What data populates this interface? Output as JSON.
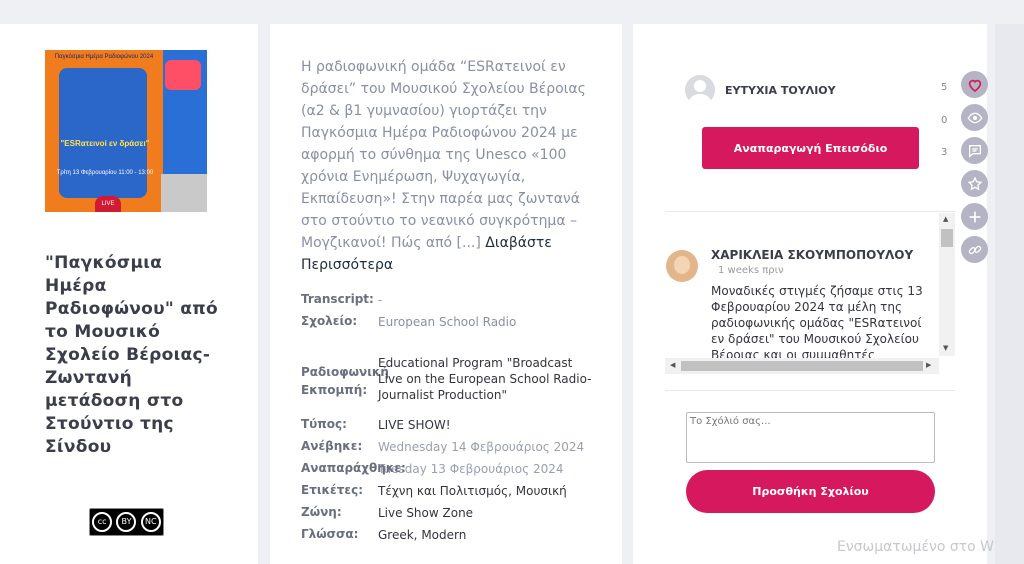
{
  "episode": {
    "poster": {
      "top_text": "Παγκόσμια Ημέρα Ραδιοφώνου 2024",
      "middle_text": "\"ESRατεινοί εν δράσει\"",
      "bottom_text": "Τρίτη 13 Φεβρουαρίου 11:00 - 13:00",
      "live_badge": "LIVE"
    },
    "title": "\"Παγκόσμια Ημέρα Ραδιοφώνου\" από το Μουσικό Σχολείο Βέροιας- Ζωντανή μετάδοση στο Στούντιο της Σίνδου",
    "license": {
      "by": "BY",
      "nc": "NC"
    }
  },
  "description": {
    "text": "Η ραδιοφωνική ομάδα “ESRατεινοί εν δράσει” του Μουσικού Σχολείου Βέροιας (α2 & β1 γυμνασίου) γιορτάζει την Παγκόσμια Ημέρα Ραδιοφώνου 2024 με αφορμή το σύνθημα της Unesco «100 χρόνια Ενημέρωση, Ψυχαγωγία, Εκπαίδευση»! Στην παρέα μας ζωντανά στο στούντιο το νεανικό συγκρότημα – Μογζικανοί! Πώς από",
    "ellipsis": "[...]",
    "read_more": "Διαβάστε Περισσότερα"
  },
  "meta": {
    "transcript_label": "Transcript:",
    "transcript_value": "-",
    "school_label": "Σχολείο:",
    "school_value": "European School Radio",
    "program_label": "Ραδιοφωνική Εκπομπή:",
    "program_value": "Educational Program \"Broadcast Live on the European School Radio- Journalist Production\"",
    "type_label": "Τύπος:",
    "type_value": "LIVE SHOW!",
    "uploaded_label": "Ανέβηκε:",
    "uploaded_value": "Wednesday 14 Φεβρουάριος 2024",
    "played_label": "Αναπαράχθηκε:",
    "played_value": "Tuesday 13 Φεβρουάριος 2024",
    "tags_label": "Ετικέτες:",
    "tags_value": "Τέχνη και Πολιτισμός, Μουσική",
    "zone_label": "Ζώνη:",
    "zone_value": "Live Show Zone",
    "language_label": "Γλώσσα:",
    "language_value": "Greek, Modern"
  },
  "player": {
    "author": "ΕΥΤΥΧΙΑ ΤΟΥΛΙΟΥ",
    "play_label": "Αναπαραγωγή Επεισόδιο"
  },
  "counts": {
    "likes": "5",
    "views": "0",
    "comments": "3"
  },
  "comment": {
    "name": "ΧΑΡΙΚΛΕΙΑ ΣΚΟΥΜΠΟΠΟΥΛΟΥ",
    "time": "1 weeks πριν",
    "text": "Μοναδικές στιγμές ζήσαμε στις 13 Φεβρουαρίου 2024 τα μέλη της ραδιοφωνικής ομάδας \"ESRατεινοί εν δράσει\" του Μουσικού Σχολείου Βέροιας και οι συμμαθητές"
  },
  "comment_form": {
    "placeholder": "Το Σχόλιό σας...",
    "submit_label": "Προσθήκη Σχολίου"
  },
  "footer": {
    "partial_text": "Ενσωματωμένο στο W"
  },
  "colors": {
    "accent": "#d6185e",
    "side_buttons": "#b4b4c4"
  }
}
